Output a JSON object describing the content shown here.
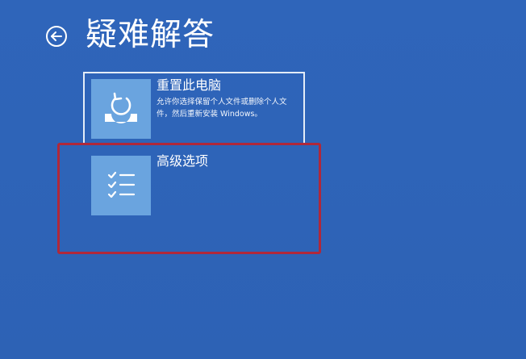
{
  "page": {
    "title": "疑难解答",
    "back_icon": "back-arrow-icon",
    "background_color": "#2f64b8"
  },
  "options": [
    {
      "title": "重置此电脑",
      "description": "允许你选择保留个人文件或删除个人文件，然后重新安装 Windows。",
      "icon": "reset-pc-icon",
      "selected_outline": true
    },
    {
      "title": "高级选项",
      "description": "",
      "icon": "checklist-icon",
      "selected_outline": false
    }
  ],
  "annotation": {
    "highlight_color": "#b0283a"
  }
}
